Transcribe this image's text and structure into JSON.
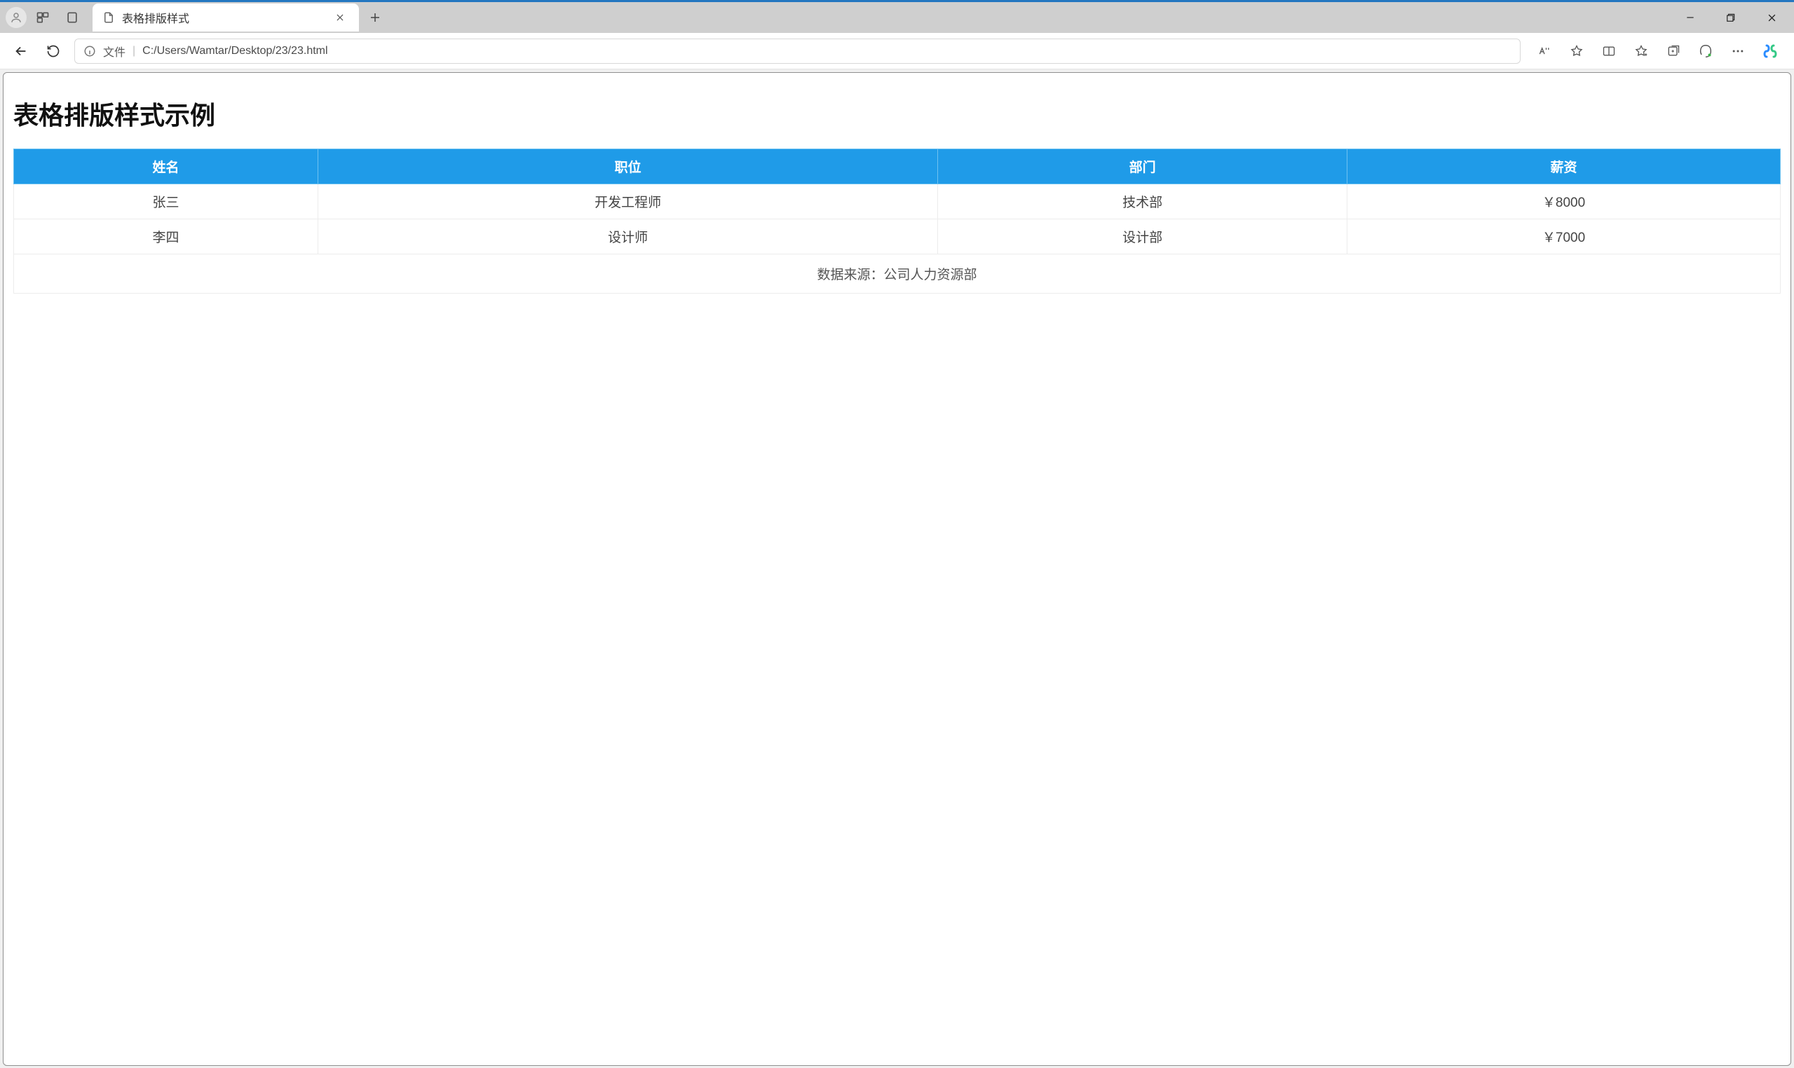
{
  "browser": {
    "tab_title": "表格排版样式",
    "addr_hint": "文件",
    "url": "C:/Users/Wamtar/Desktop/23/23.html"
  },
  "page": {
    "heading": "表格排版样式示例",
    "table": {
      "headers": [
        "姓名",
        "职位",
        "部门",
        "薪资"
      ],
      "rows": [
        {
          "name": "张三",
          "role": "开发工程师",
          "dept": "技术部",
          "salary": "￥8000"
        },
        {
          "name": "李四",
          "role": "设计师",
          "dept": "设计部",
          "salary": "￥7000"
        }
      ],
      "footer": "数据来源：公司人力资源部"
    }
  }
}
